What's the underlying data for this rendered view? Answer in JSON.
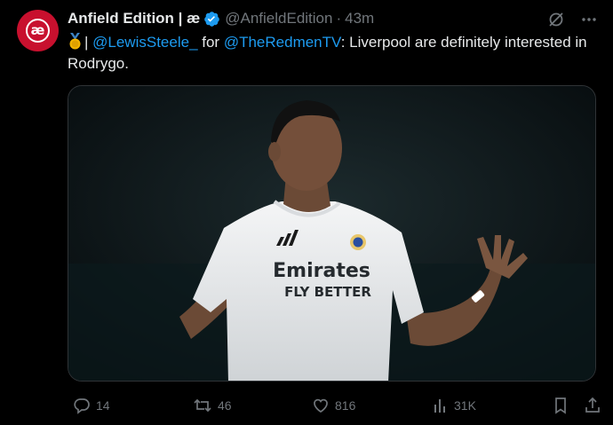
{
  "post": {
    "display_name": "Anfield Edition | æ",
    "handle": "@AnfieldEdition",
    "separator": "·",
    "time": "43m",
    "avatar_glyph": "æ",
    "avatar_color": "#c8102e",
    "verified_color": "#1d9bf0",
    "text": {
      "medal": "🥇",
      "prefix": "| ",
      "mention1": "@LewisSteele_",
      "middle": " for ",
      "mention2": "@TheRedmenTV",
      "rest": ": Liverpool are definitely interested in Rodrygo."
    },
    "image": {
      "sponsor_line1": "Emirates",
      "sponsor_line2": "FLY BETTER"
    },
    "actions": {
      "replies": "14",
      "reposts": "46",
      "likes": "816",
      "views": "31K"
    }
  },
  "icons": [
    "grok-icon",
    "more-icon",
    "reply-icon",
    "repost-icon",
    "like-icon",
    "views-icon",
    "bookmark-icon",
    "share-icon"
  ],
  "colors": {
    "background": "#000000",
    "text": "#e7e9ea",
    "muted": "#71767b",
    "link": "#1d9bf0"
  }
}
